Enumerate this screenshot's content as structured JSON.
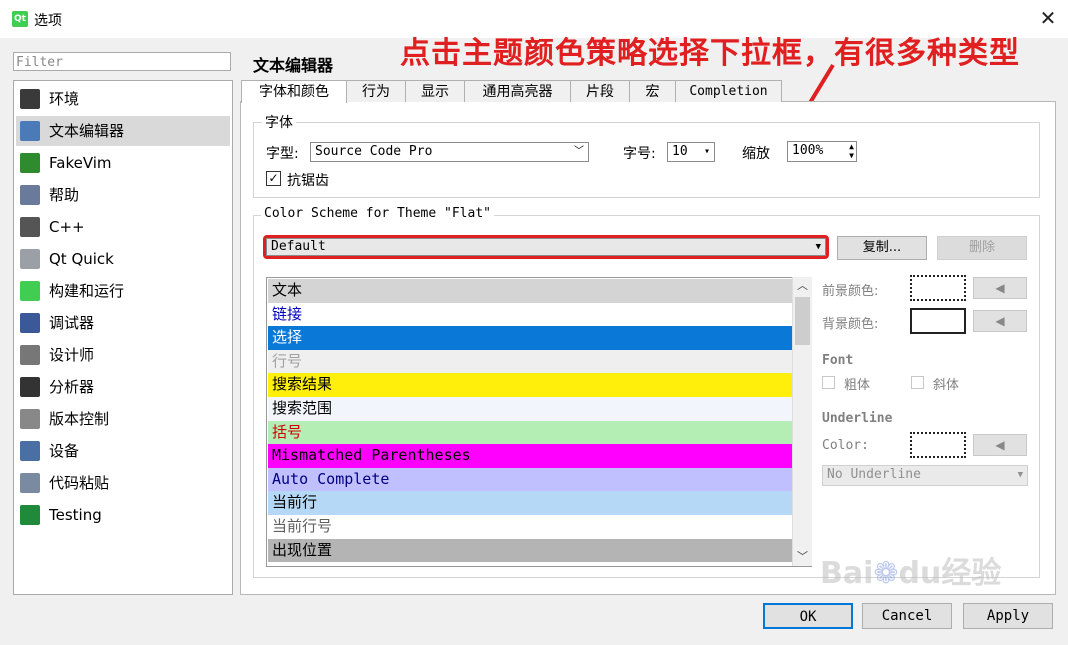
{
  "window": {
    "title": "选项",
    "app_icon": "Qt"
  },
  "annotation": "点击主题颜色策略选择下拉框，有很多种类型",
  "filter": {
    "placeholder": "Filter"
  },
  "sidebar": {
    "items": [
      {
        "label": "环境",
        "icon": "environment-icon",
        "color": "#3a3a3a"
      },
      {
        "label": "文本编辑器",
        "icon": "text-editor-icon",
        "color": "#4a7ab8",
        "selected": true
      },
      {
        "label": "FakeVim",
        "icon": "fakevim-icon",
        "color": "#2e8b2e"
      },
      {
        "label": "帮助",
        "icon": "help-icon",
        "color": "#6a7a9a"
      },
      {
        "label": "C++",
        "icon": "cpp-icon",
        "color": "#555555"
      },
      {
        "label": "Qt Quick",
        "icon": "qt-quick-icon",
        "color": "#9aa0a6"
      },
      {
        "label": "构建和运行",
        "icon": "build-run-icon",
        "color": "#41cd52"
      },
      {
        "label": "调试器",
        "icon": "debugger-icon",
        "color": "#3b5998"
      },
      {
        "label": "设计师",
        "icon": "designer-icon",
        "color": "#777777"
      },
      {
        "label": "分析器",
        "icon": "analyzer-icon",
        "color": "#333333"
      },
      {
        "label": "版本控制",
        "icon": "version-control-icon",
        "color": "#888888"
      },
      {
        "label": "设备",
        "icon": "devices-icon",
        "color": "#4a6fa5"
      },
      {
        "label": "代码粘贴",
        "icon": "code-paste-icon",
        "color": "#7a8aa0"
      },
      {
        "label": "Testing",
        "icon": "testing-icon",
        "color": "#1e8a3a"
      }
    ]
  },
  "page_title": "文本编辑器",
  "tabs": [
    {
      "label": "字体和颜色",
      "active": true
    },
    {
      "label": "行为"
    },
    {
      "label": "显示"
    },
    {
      "label": "通用高亮器"
    },
    {
      "label": "片段"
    },
    {
      "label": "宏"
    },
    {
      "label": "Completion"
    }
  ],
  "font_group": {
    "title": "字体",
    "family_label": "字型:",
    "family_value": "Source Code Pro",
    "size_label": "字号:",
    "size_value": "10",
    "zoom_label": "缩放",
    "zoom_value": "100%",
    "antialias_label": "抗锯齿",
    "antialias_checked": true
  },
  "scheme_group": {
    "title": "Color Scheme for Theme \"Flat\"",
    "scheme_value": "Default",
    "copy_label": "复制...",
    "delete_label": "删除"
  },
  "scheme_items": [
    {
      "label": "文本",
      "fg": "#000000",
      "bg": "#d4d4d4"
    },
    {
      "label": "链接",
      "fg": "#0000c0",
      "bg": "#ffffff"
    },
    {
      "label": "选择",
      "fg": "#ffffff",
      "bg": "#0a78d7"
    },
    {
      "label": "行号",
      "fg": "#a0a0a0",
      "bg": "#efefef"
    },
    {
      "label": "搜索结果",
      "fg": "#000000",
      "bg": "#ffef0b"
    },
    {
      "label": "搜索范围",
      "fg": "#000000",
      "bg": "#f2f6fc"
    },
    {
      "label": "括号",
      "fg": "#d00000",
      "bg": "#b4eeb4"
    },
    {
      "label": "Mismatched Parentheses",
      "fg": "#000000",
      "bg": "#ff00ff"
    },
    {
      "label": "Auto Complete",
      "fg": "#000080",
      "bg": "#c0c0ff"
    },
    {
      "label": "当前行",
      "fg": "#000000",
      "bg": "#b4d8f5"
    },
    {
      "label": "当前行号",
      "fg": "#606060",
      "bg": "#ffffff"
    },
    {
      "label": "出现位置",
      "fg": "#000000",
      "bg": "#b4b4b4"
    }
  ],
  "props": {
    "foreground_label": "前景颜色:",
    "background_label": "背景颜色:",
    "font_label": "Font",
    "bold_label": "粗体",
    "italic_label": "斜体",
    "underline_label": "Underline",
    "color_label": "Color:",
    "underline_value": "No Underline"
  },
  "buttons": {
    "ok": "OK",
    "cancel": "Cancel",
    "apply": "Apply"
  },
  "watermark": "Baidu经验 jingyan.baidu.com"
}
